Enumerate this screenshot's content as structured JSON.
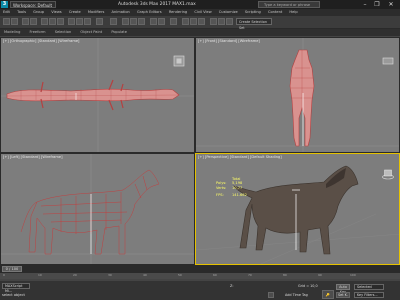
{
  "titlebar": {
    "logo": "3",
    "workspace": "Workspace: Default",
    "title": "Autodesk 3ds Max 2017      MAX1.max",
    "search_placeholder": "Type a keyword or phrase",
    "minimize": "–",
    "maximize": "❐",
    "close": "✕"
  },
  "menubar": {
    "items": [
      "Edit",
      "Tools",
      "Group",
      "Views",
      "Create",
      "Modifiers",
      "Animation",
      "Graph Editors",
      "Rendering",
      "Civil View",
      "Customize",
      "Scripting",
      "Content",
      "Help"
    ]
  },
  "toolbar": {
    "selection_set": "Create Selection Set"
  },
  "ribbon": {
    "tabs": [
      "Modeling",
      "Freeform",
      "Selection",
      "Object Paint",
      "Populate"
    ]
  },
  "viewports": {
    "top": {
      "label": "[+] [Orthographic] [Standard] [Wireframe]"
    },
    "front": {
      "label": "[+] [Front] [Standard] [Wireframe]"
    },
    "left": {
      "label": "[+] [Left] [Standard] [Wireframe]"
    },
    "perspective": {
      "label": "[+] [Perspective] [Standard] [Default Shading]"
    }
  },
  "stats": {
    "title": "Total",
    "polys_label": "Polys:",
    "polys_value": "5,198",
    "verts_label": "Verts:",
    "verts_value": "10,77",
    "fps_label": "FPS:",
    "fps_value": "141.662"
  },
  "timeline": {
    "slider": "0 / 100",
    "ticks": [
      "0",
      "10",
      "20",
      "30",
      "40",
      "50",
      "60",
      "70",
      "80",
      "90",
      "100"
    ]
  },
  "status": {
    "maxscript": "MAXScript Mi...",
    "selected": "select object",
    "add_time_tag": "Add Time Tag",
    "autokey": "Auto Key",
    "setkey": "Set K.",
    "selected_dropdown": "Selected",
    "key_filters": "Key Filters...",
    "z_label": "Z:",
    "grid_label": "Grid = 10,0"
  }
}
